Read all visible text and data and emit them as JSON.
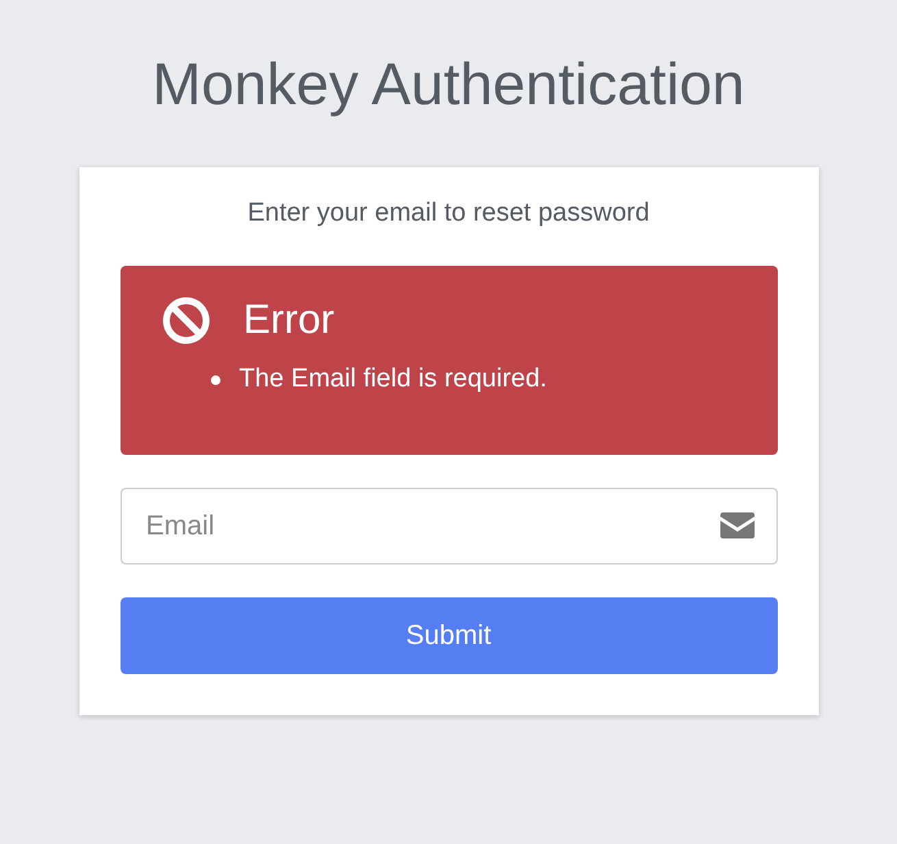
{
  "title": "Monkey Authentication",
  "card": {
    "subtitle": "Enter your email to reset password",
    "error": {
      "heading": "Error",
      "messages": [
        "The Email field is required."
      ]
    },
    "email_field": {
      "placeholder": "Email"
    },
    "submit_button": "Submit"
  }
}
